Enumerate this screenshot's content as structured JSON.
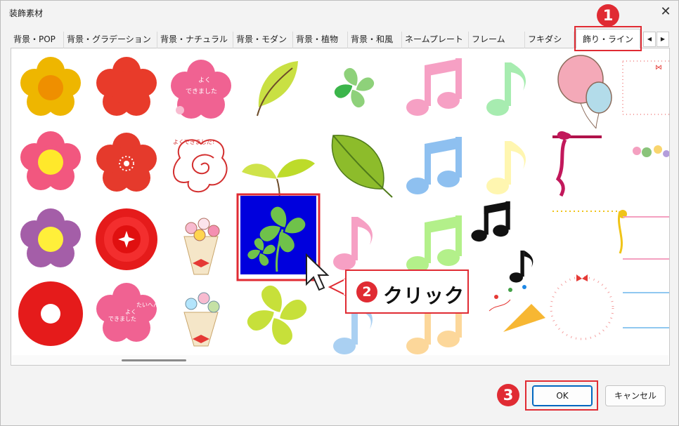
{
  "dialog": {
    "title": "装飾素材",
    "close_glyph": "✕"
  },
  "tabs": [
    {
      "label": "背景・POP"
    },
    {
      "label": "背景・グラデーション"
    },
    {
      "label": "背景・ナチュラル"
    },
    {
      "label": "背景・モダン"
    },
    {
      "label": "背景・植物"
    },
    {
      "label": "背景・和風"
    },
    {
      "label": "ネームプレート"
    },
    {
      "label": "フレーム"
    },
    {
      "label": "フキダシ"
    },
    {
      "label": "飾り・ライン"
    }
  ],
  "tab_scroll": {
    "left": "◀",
    "right": "▶"
  },
  "gallery": {
    "texts": {
      "sakura1": [
        "よく",
        "できました"
      ],
      "spiral_caption": "よくできました！",
      "sakura2": [
        "たいへん",
        "よく",
        "できました"
      ]
    },
    "selected_item": "four-leaf-clover-blue"
  },
  "annotations": {
    "step1": "1",
    "step2": "2",
    "step2_text": "クリック",
    "step3": "3"
  },
  "buttons": {
    "ok": "OK",
    "cancel": "キャンセル"
  },
  "colors": {
    "accent_red": "#e02b33",
    "ok_border": "#0067c0",
    "selection_blue": "#0000dd"
  }
}
